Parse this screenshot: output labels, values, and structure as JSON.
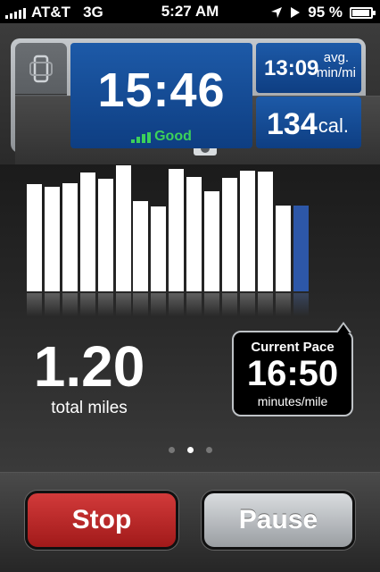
{
  "status_bar": {
    "carrier": "AT&T",
    "network": "3G",
    "time": "5:27 AM",
    "battery": "95 %",
    "battery_level": 0.95,
    "icons": [
      "signal-icon",
      "location-arrow-icon",
      "play-icon",
      "battery-icon"
    ]
  },
  "metrics": {
    "duration": "15:46",
    "gps_status": "Good",
    "avg_pace_value": "13:09",
    "avg_pace_unit_line1": "avg.",
    "avg_pace_unit_line2": "min/mi",
    "calories_value": "134",
    "calories_unit": "cal.",
    "side_buttons": [
      "phone-orientation-icon",
      "camera-icon"
    ]
  },
  "pace_chart": {
    "type": "bar",
    "values": [
      118,
      115,
      119,
      131,
      124,
      139,
      100,
      94,
      135,
      126,
      110,
      125,
      133,
      132,
      95,
      95
    ],
    "current_index": 15,
    "max": 140
  },
  "distance": {
    "value": "1.20",
    "label": "total miles"
  },
  "current_pace": {
    "title": "Current Pace",
    "value": "16:50",
    "unit": "minutes/mile"
  },
  "pager": {
    "count": 3,
    "active": 1
  },
  "buttons": {
    "stop": "Stop",
    "pause": "Pause"
  },
  "colors": {
    "panel_blue": "#1d5aa8",
    "gps_green": "#3cd15a",
    "stop_red": "#c22a2a",
    "current_bar": "#2d57a8"
  }
}
